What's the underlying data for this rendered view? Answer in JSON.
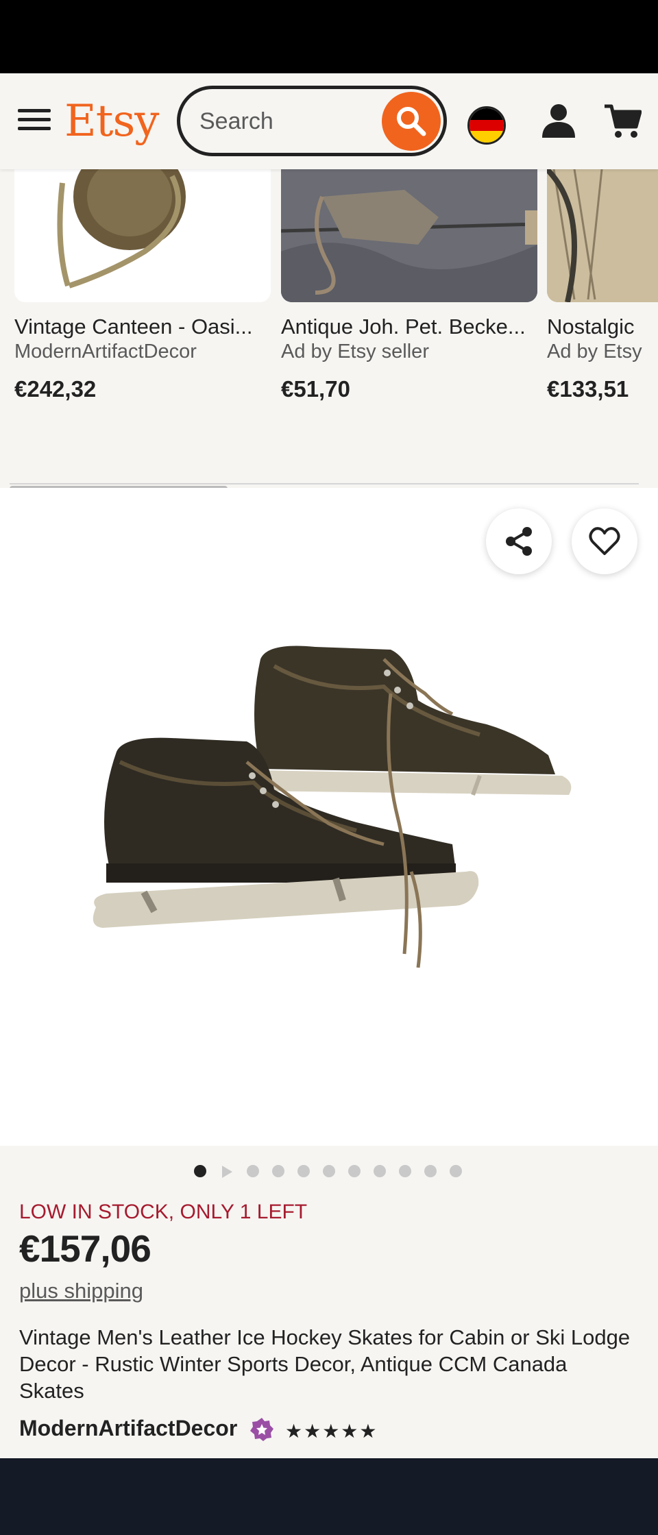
{
  "header": {
    "logo": "Etsy",
    "search_placeholder": "Search"
  },
  "carousel": {
    "items": [
      {
        "title": "Vintage Canteen - Oasi...",
        "subtitle": "ModernArtifactDecor",
        "price": "€242,32"
      },
      {
        "title": "Antique Joh. Pet. Becke...",
        "subtitle": "Ad by Etsy seller",
        "price": "€51,70"
      },
      {
        "title": "Nostalgic",
        "subtitle": "Ad by Etsy",
        "price": "€133,51"
      }
    ]
  },
  "listing": {
    "image_count": 11,
    "current_image": 1,
    "stock_notice": "LOW IN STOCK, ONLY 1 LEFT",
    "price": "€157,06",
    "shipping_link": "plus shipping",
    "title": "Vintage Men's Leather Ice Hockey Skates for Cabin or Ski Lodge Decor - Rustic Winter Sports Decor, Antique CCM Canada Skates",
    "shop_name": "ModernArtifactDecor",
    "rating": 5,
    "stars": "★★★★★"
  },
  "colors": {
    "brand": "#f1641e",
    "stock_red": "#a61a2e",
    "background": "#f6f5f2"
  },
  "icons": [
    "menu-icon",
    "search-icon",
    "german-flag-icon",
    "user-icon",
    "cart-icon",
    "share-icon",
    "heart-icon",
    "star-seller-icon",
    "video-play-icon"
  ]
}
